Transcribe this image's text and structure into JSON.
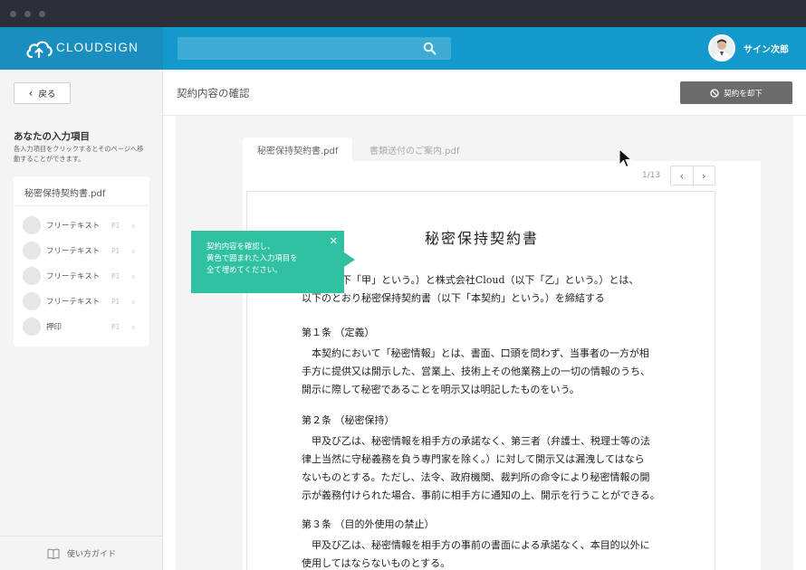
{
  "app": {
    "logo_text": "CLOUDSIGN",
    "brand_color": "#1499cc",
    "accent_color": "#2fc1a1"
  },
  "header": {
    "search_placeholder": "",
    "user_name": "サイン次郎"
  },
  "sidebar": {
    "back_label": "戻る",
    "title": "あなたの入力項目",
    "description": "各入力項目をクリックするとそのページへ移動することができます。",
    "file_name": "秘密保持契約書.pdf",
    "items": [
      {
        "label": "フリーテキスト",
        "page": "P1"
      },
      {
        "label": "フリーテキスト",
        "page": "P1"
      },
      {
        "label": "フリーテキスト",
        "page": "P1"
      },
      {
        "label": "フリーテキスト",
        "page": "P1"
      },
      {
        "label": "押印",
        "page": "P1"
      }
    ],
    "guide_label": "使い方ガイド"
  },
  "main": {
    "page_title": "契約内容の確認",
    "reject_label": "契約を却下",
    "tabs": [
      {
        "label": "秘密保持契約書.pdf",
        "active": true
      },
      {
        "label": "書類送付のご案内.pdf",
        "active": false
      }
    ],
    "page_count": "1/13"
  },
  "tooltip": {
    "lines": [
      "契約内容を確認し、",
      "黄色で囲まれた入力項目を",
      "全て埋めてください。"
    ]
  },
  "document": {
    "title": "秘密保持契約書",
    "intro": [
      "当社（以下「甲」という。）と株式会社Cloud（以下「乙」という。）とは、",
      "以下のとおり秘密保持契約書（以下「本契約」という。）を締結する"
    ],
    "article1_heading": "第１条 （定義）",
    "article1": [
      "本契約において「秘密情報」とは、書面、口頭を問わず、当事者の一方が相",
      "手方に提供又は開示した、営業上、技術上その他業務上の一切の情報のうち、",
      "開示に際して秘密であることを明示又は明記したものをいう。"
    ],
    "article2_heading": "第２条 （秘密保持）",
    "article2": [
      "甲及び乙は、秘密情報を相手方の承諾なく、第三者（弁護士、税理士等の法",
      "律上当然に守秘義務を負う専門家を除く。）に対して開示又は漏洩してはなら",
      "ないものとする。ただし、法令、政府機関、裁判所の命令により秘密情報の開",
      "示が義務付けられた場合、事前に相手方に通知の上、開示を行うことができる。"
    ],
    "article3_heading": "第３条 （目的外使用の禁止）",
    "article3": [
      "甲及び乙は、秘密情報を相手方の事前の書面による承諾なく、本目的以外に",
      "使用してはならないものとする。"
    ]
  }
}
